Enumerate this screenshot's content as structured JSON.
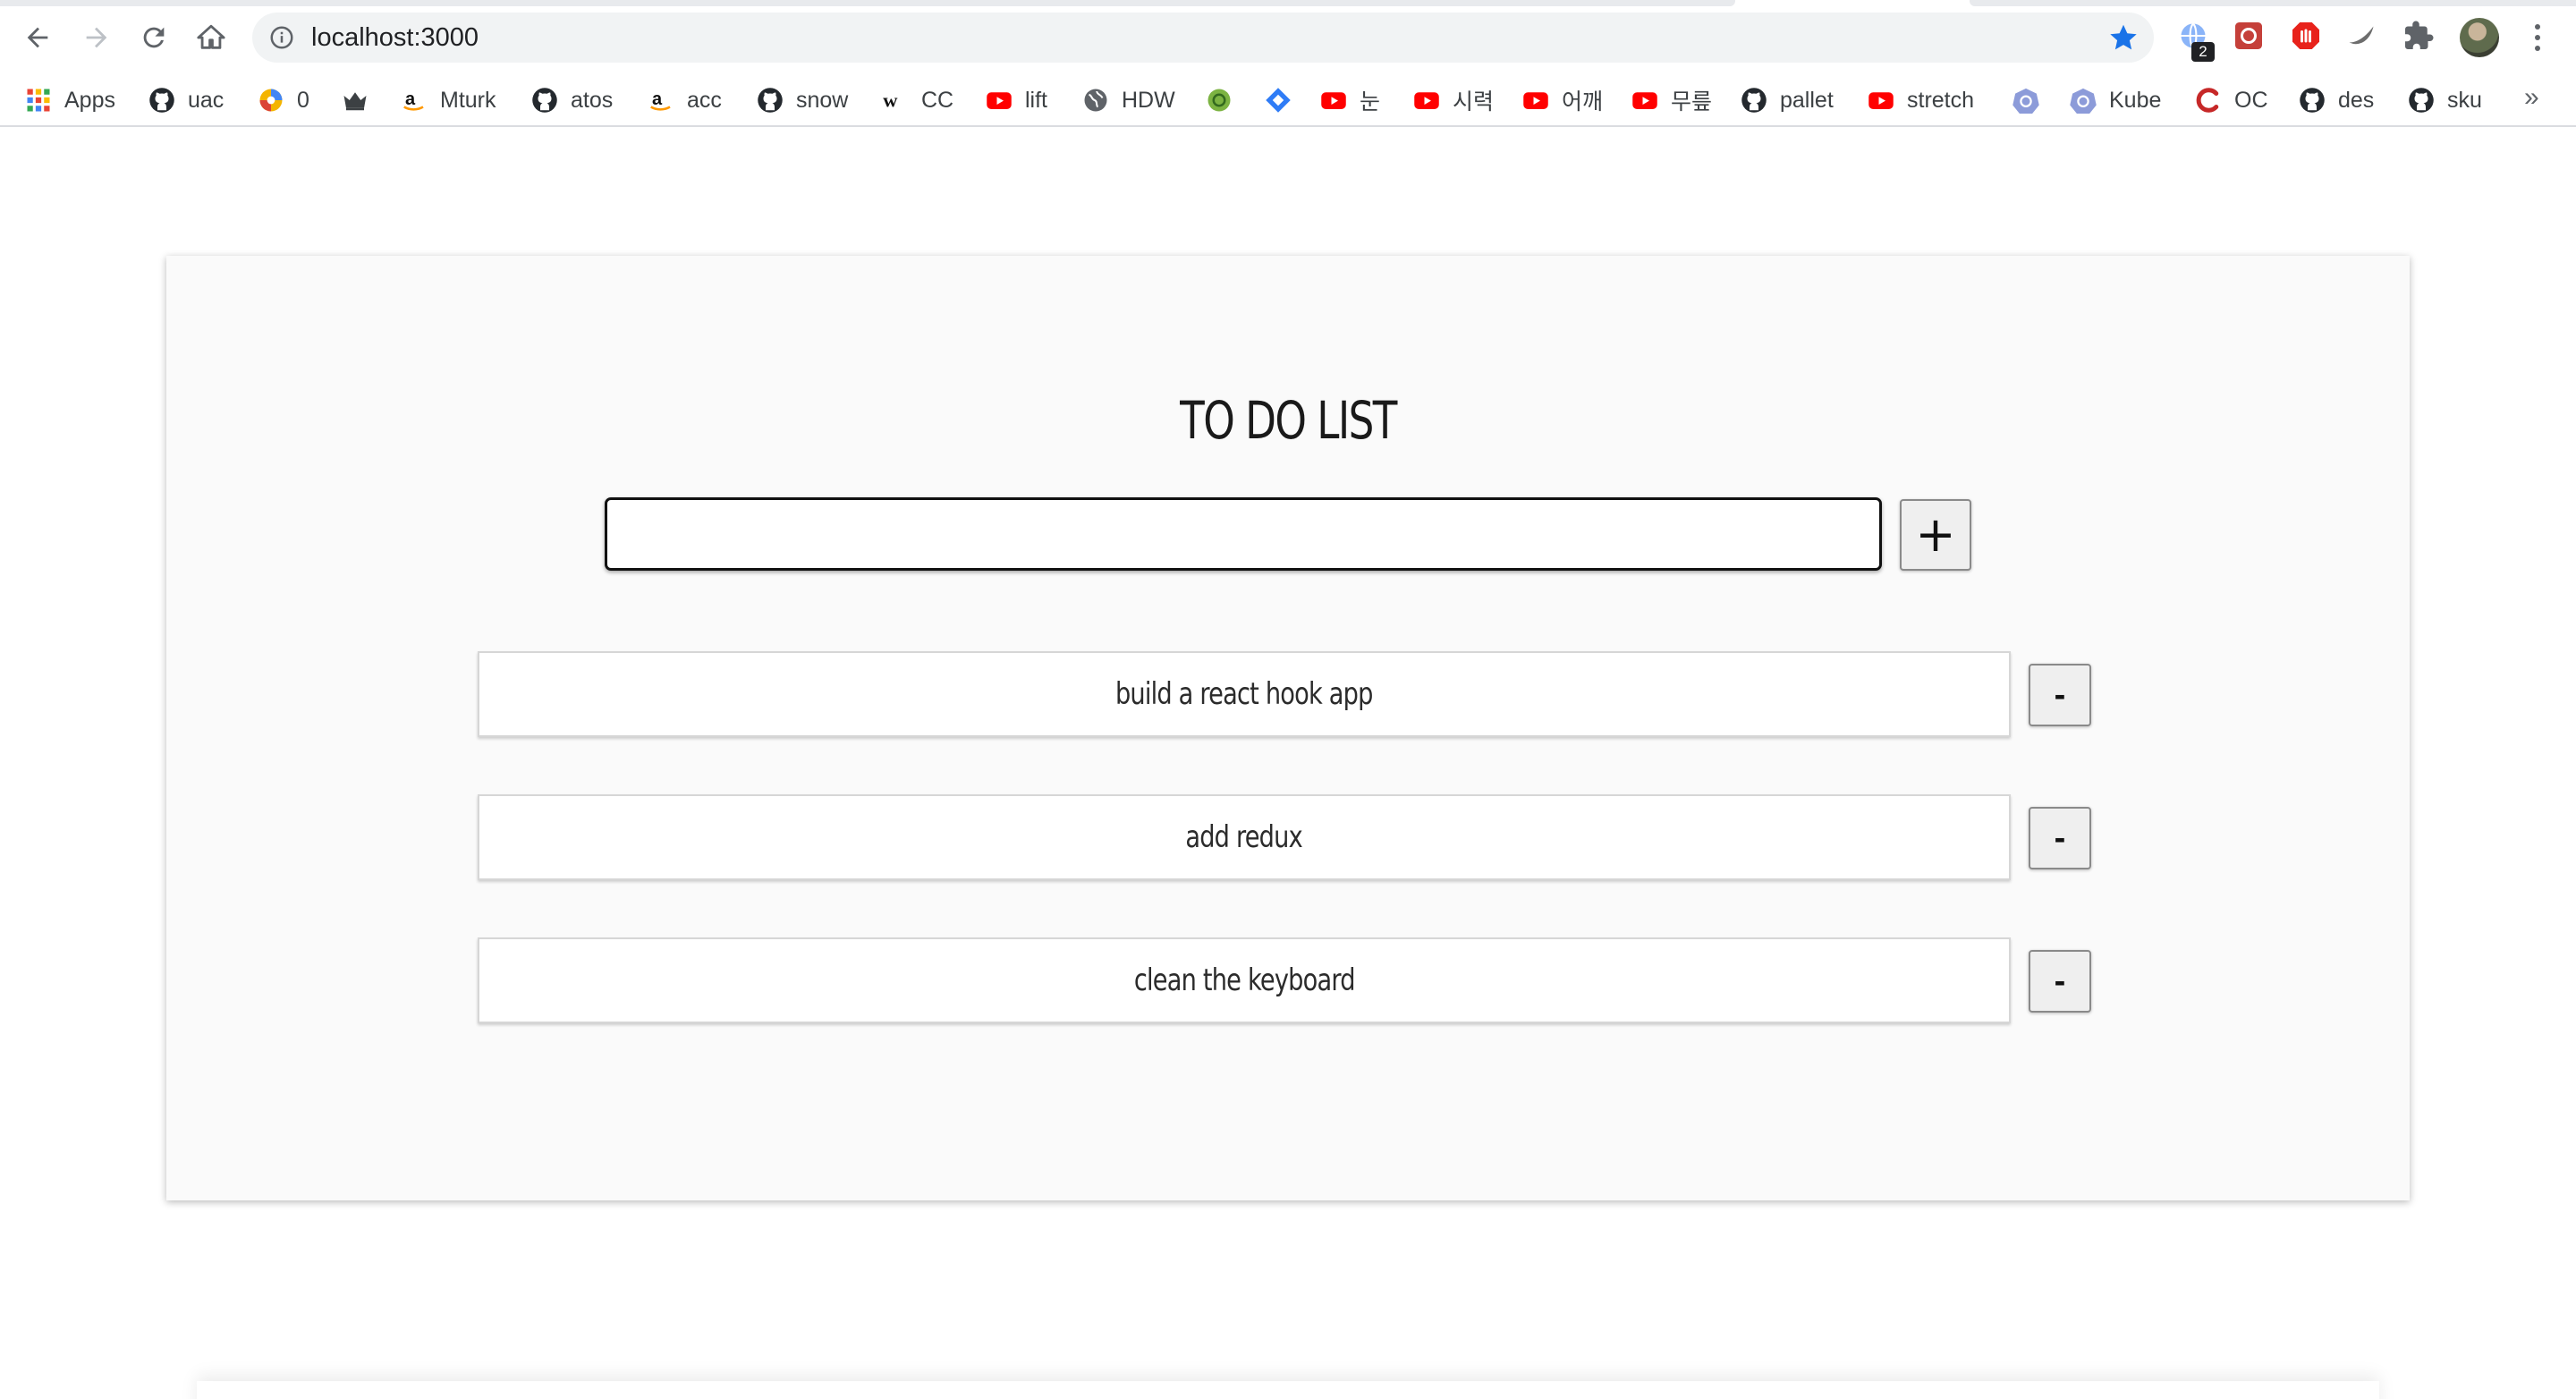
{
  "browser": {
    "url": "localhost:3000",
    "extension_badge": "2",
    "more_bookmarks": "»"
  },
  "bookmarks": [
    {
      "label": "Apps",
      "icon": "apps-grid-icon"
    },
    {
      "label": "uac",
      "icon": "github-icon"
    },
    {
      "label": "0",
      "icon": "colorful-ball-icon"
    },
    {
      "label": "",
      "icon": "crown-icon"
    },
    {
      "label": "Mturk",
      "icon": "amazon-icon"
    },
    {
      "label": "atos",
      "icon": "github-icon"
    },
    {
      "label": "acc",
      "icon": "amazon-icon"
    },
    {
      "label": "snow",
      "icon": "github-icon"
    },
    {
      "label": "CC",
      "icon": "w-icon"
    },
    {
      "label": "lift",
      "icon": "youtube-icon"
    },
    {
      "label": "HDW",
      "icon": "globe-icon"
    },
    {
      "label": "",
      "icon": "green-circle-icon"
    },
    {
      "label": "",
      "icon": "blue-diamond-icon"
    },
    {
      "label": "눈",
      "icon": "youtube-icon"
    },
    {
      "label": "시력",
      "icon": "youtube-icon"
    },
    {
      "label": "어깨",
      "icon": "youtube-icon"
    },
    {
      "label": "무릎",
      "icon": "youtube-icon"
    },
    {
      "label": "pallet",
      "icon": "github-icon"
    },
    {
      "label": "stretch",
      "icon": "youtube-icon"
    },
    {
      "label": "",
      "icon": "kubernetes-icon"
    },
    {
      "label": "Kube",
      "icon": "kubernetes-icon"
    },
    {
      "label": "OC",
      "icon": "c-logo-icon"
    },
    {
      "label": "des",
      "icon": "github-icon"
    },
    {
      "label": "sku",
      "icon": "github-icon"
    }
  ],
  "app": {
    "title": "TO DO LIST",
    "input_value": "",
    "add_label": "+",
    "remove_label": "-",
    "todos": [
      {
        "text": "build a react hook app"
      },
      {
        "text": "add redux"
      },
      {
        "text": "clean the keyboard"
      }
    ]
  },
  "colors": {
    "star": "#1a73e8",
    "youtube": "#ff0000",
    "github": "#24292e",
    "card_bg": "#fafafa"
  }
}
